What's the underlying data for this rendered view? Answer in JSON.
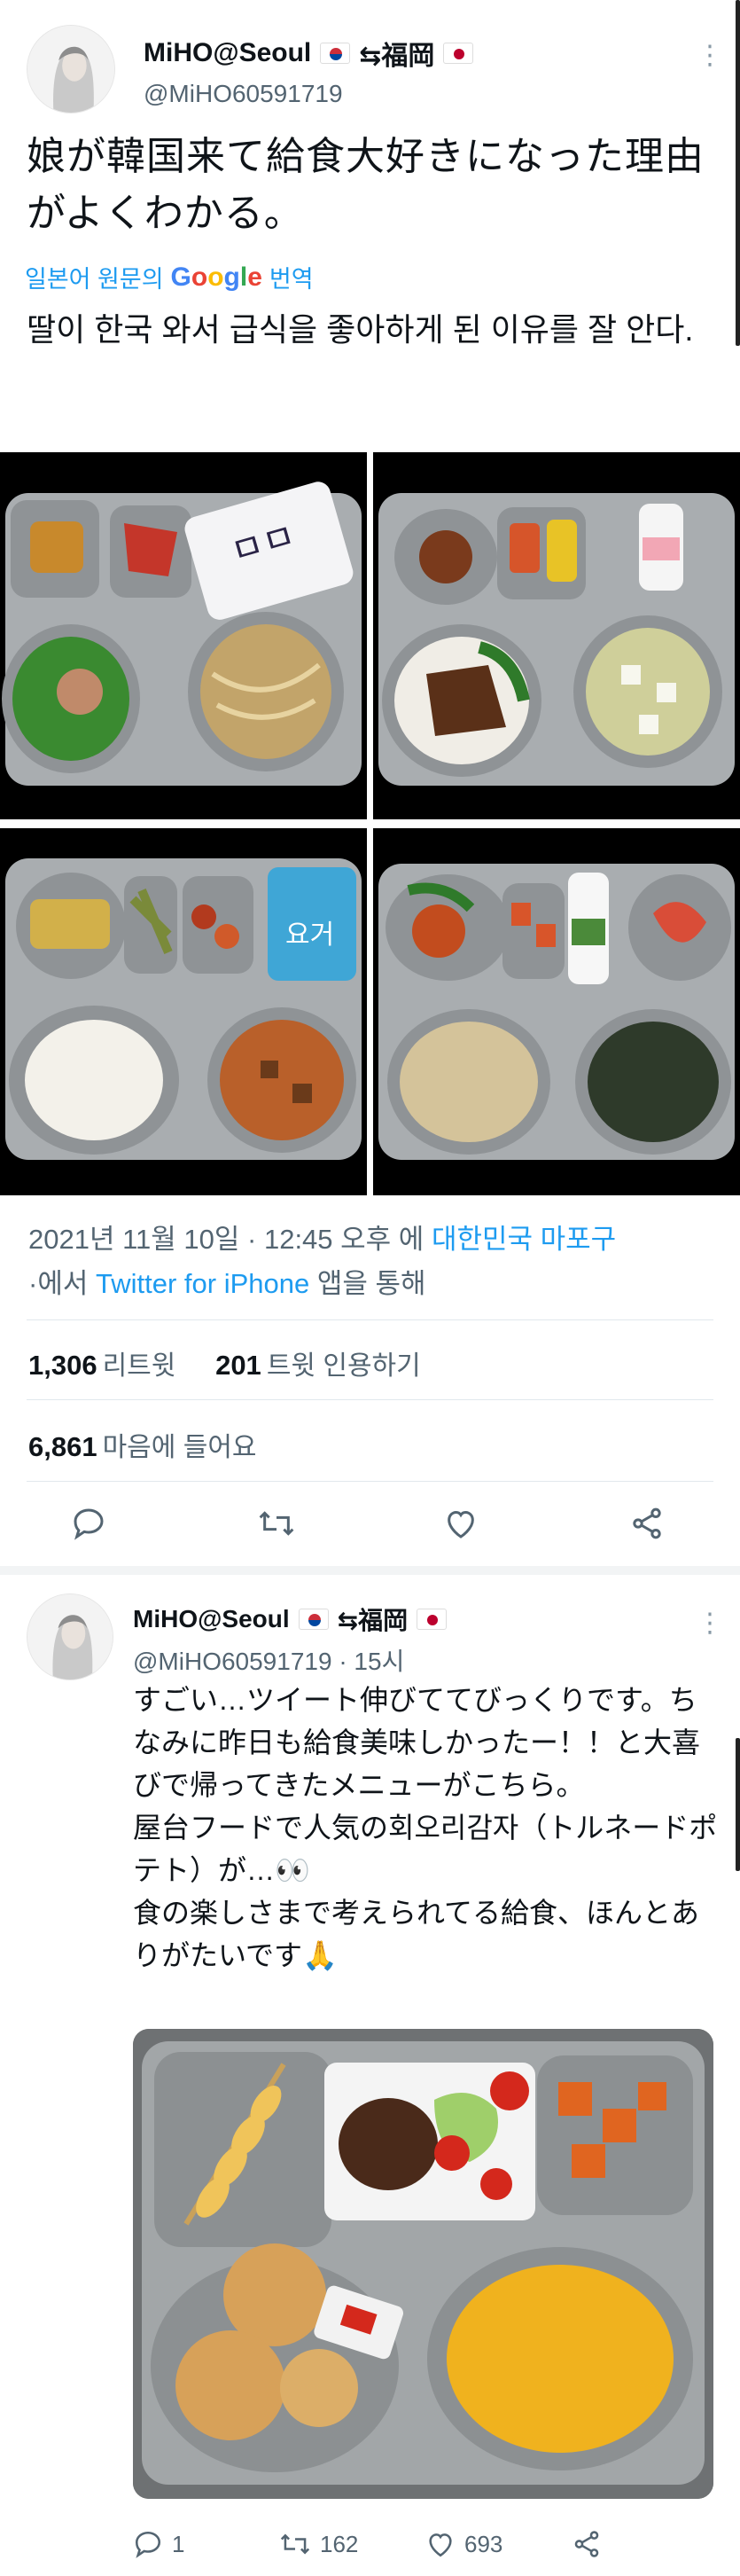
{
  "tweet": {
    "display_name": "MiHO@Seoul",
    "name_suffix": "⇆福岡",
    "handle": "@MiHO60591719",
    "text_jp": "娘が韓国来て給食大好きになった理由がよくわかる。",
    "translate_label": "일본어 원문의",
    "translate_google": [
      "G",
      "o",
      "o",
      "g",
      "l",
      "e"
    ],
    "translate_suffix": "번역",
    "text_ko": "딸이 한국 와서 급식을 좋아하게 된 이유를 잘 안다.",
    "timestamp": "2021년 11월 10일 · 12:45 오후 에",
    "location": "대한민국 마포구",
    "via_prefix": "·에서",
    "client": "Twitter for iPhone",
    "via_suffix": "앱을 통해",
    "retweets_count": "1,306",
    "retweets_label": "리트윗",
    "quotes_count": "201",
    "quotes_label": "트윗 인용하기",
    "likes_count": "6,861",
    "likes_label": "마음에 들어요"
  },
  "reply": {
    "display_name": "MiHO@Seoul",
    "name_suffix": "⇆福岡",
    "handle_time": "@MiHO60591719 · 15시",
    "text": "すごい…ツイート伸びててびっくりです。ちなみに昨日も給食美味しかったー！！と大喜びで帰ってきたメニューがこちら。\n屋台フードで人気の회오리감자（トルネードポテト）が…👀\n食の楽しさまで考えられてる給食、ほんとありがたいです🙏",
    "replies_count": "1",
    "retweets_count": "162",
    "likes_count": "693"
  },
  "icons": [
    "more-icon",
    "reply-icon",
    "retweet-icon",
    "like-icon",
    "share-icon"
  ],
  "colors": {
    "link": "#1d9bf0",
    "secondary": "#536471",
    "divider": "#e1e8ed"
  }
}
